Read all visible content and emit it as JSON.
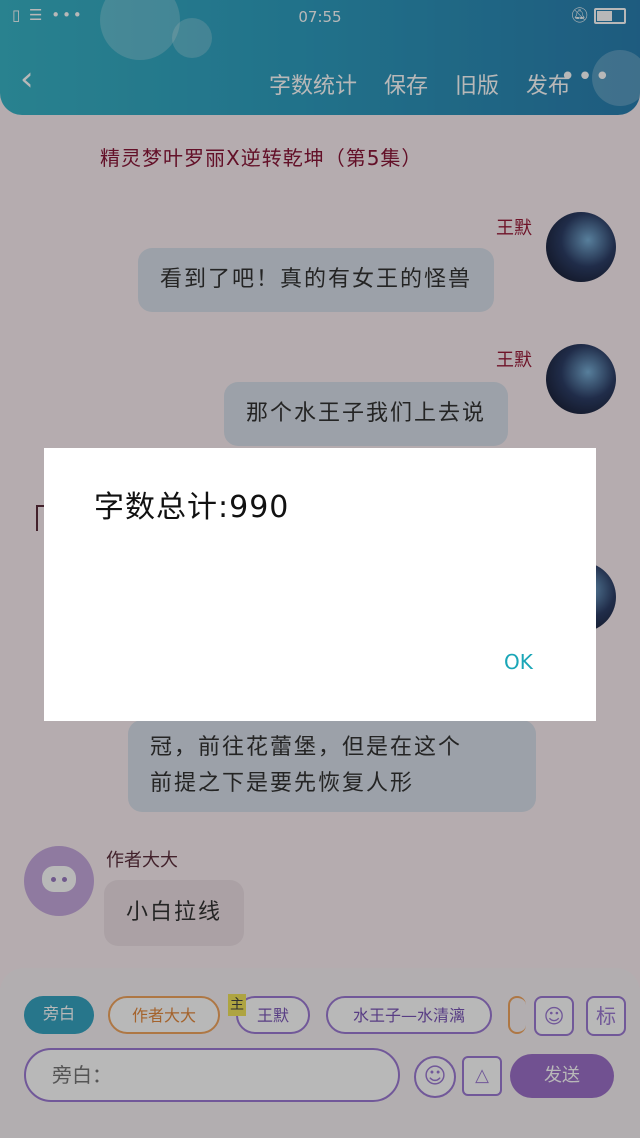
{
  "status_bar": {
    "time": "07:55",
    "left_icons": "▯ ☰ •••",
    "bell_icon": "bell-off-icon",
    "battery_icon": "battery-icon"
  },
  "header": {
    "back_icon": "chevron-left-icon",
    "menu": [
      "字数统计",
      "保存",
      "旧版",
      "发布"
    ],
    "more_icon": "•••"
  },
  "episode_title": "精灵梦叶罗丽X逆转乾坤（第5集）",
  "messages": [
    {
      "speaker": "王默",
      "text": "看到了吧！真的有女王的怪兽"
    },
    {
      "speaker": "王默",
      "text": "那个水王子我们上去说"
    },
    {
      "speaker": "",
      "lines": [
        "冠，前往花蕾堡，但是在这个",
        "前提之下是要先恢复人形"
      ]
    }
  ],
  "author_message": {
    "speaker": "作者大大",
    "text": "小白拉线"
  },
  "bottom": {
    "roles": [
      "旁白",
      "作者大大",
      "王默",
      "水王子—水清漓"
    ],
    "main_tag": "主",
    "input_placeholder": "旁白：",
    "send_label": "发送",
    "mark_label": "标",
    "person_icon": "person-icon",
    "emoji_icon": "smile-icon",
    "image_icon": "image-icon"
  },
  "dialog": {
    "text": "字数总计:990",
    "ok_label": "OK"
  },
  "colors": {
    "header_start": "#39b4c6",
    "header_end": "#2a7fb0",
    "accent_purple": "#9d71c9",
    "ok_teal": "#1aa6b7"
  }
}
